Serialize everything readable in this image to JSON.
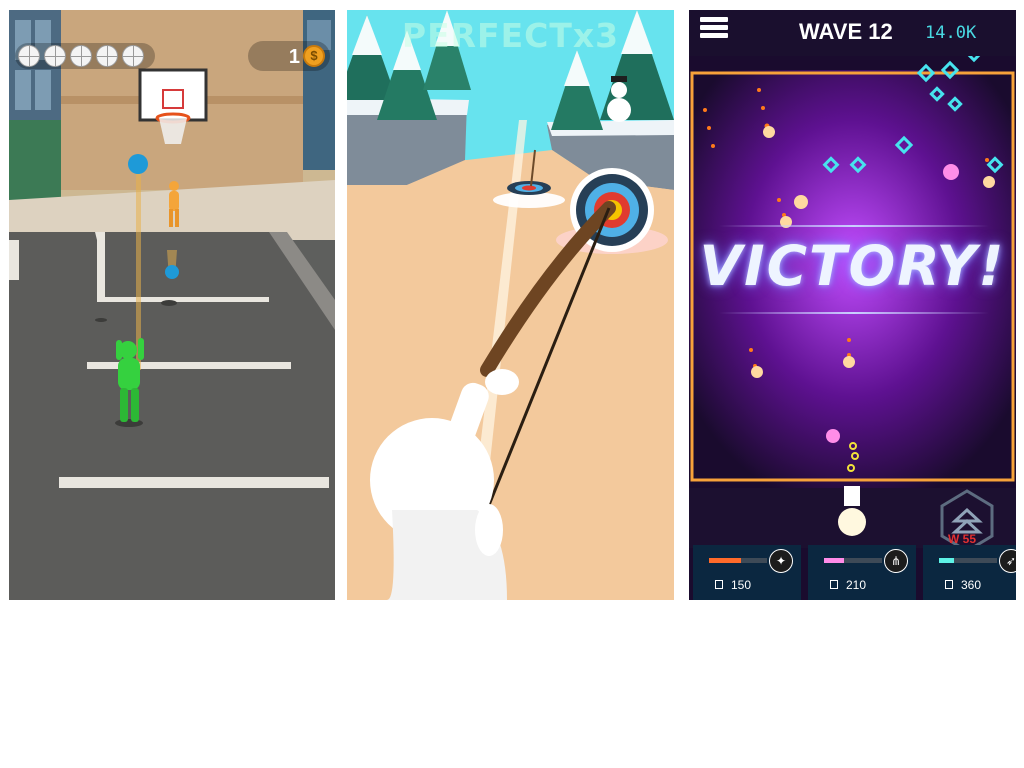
{
  "panels": [
    {
      "id": "basketball",
      "coins": "1",
      "coin_symbol": "$",
      "balls_remaining": 5,
      "colors": {
        "court": "#5e5f5d",
        "player": "#35d13f",
        "teammate": "#f4a53a",
        "ball": "#1e9ad8"
      }
    },
    {
      "id": "archery",
      "banner": "PERFECTx3",
      "colors": {
        "sand": "#f3c99c",
        "sky": "#67e3ee",
        "target_center": "#f5c400"
      }
    },
    {
      "id": "space-shooter",
      "wave_label": "WAVE 12",
      "score": "14.0K",
      "victory_text": "VICTORY!",
      "level_badge": "W 55",
      "upgrades": [
        {
          "cost": "150",
          "level": 0.55,
          "bar_color": "#ff6a2a",
          "icon": "fire-icon"
        },
        {
          "cost": "210",
          "level": 0.35,
          "bar_color": "#ff8be8",
          "icon": "spread-icon"
        },
        {
          "cost": "360",
          "level": 0.25,
          "bar_color": "#5ef2e6",
          "icon": "missile-icon"
        }
      ],
      "colors": {
        "accent": "#49d9e2",
        "frame": "#f7a23a",
        "nebula": "#7a1fbf"
      }
    }
  ]
}
